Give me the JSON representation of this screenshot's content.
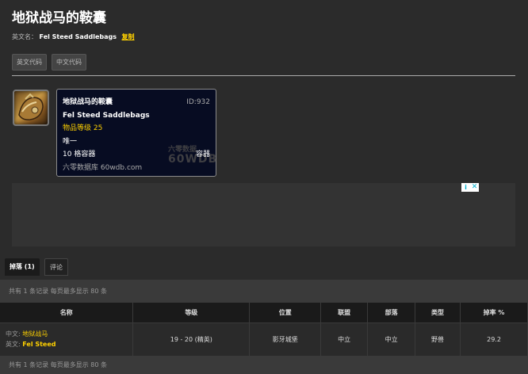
{
  "item": {
    "title": "地狱战马的鞍囊",
    "en_label": "英文名：",
    "en_name": "Fel Steed Saddlebags",
    "copy_label": "复制",
    "icon": "saddlebag-icon"
  },
  "code_buttons": {
    "en_code": "英文代码",
    "cn_code": "中文代码"
  },
  "tooltip": {
    "cn_name": "地狱战马的鞍囊",
    "id_label": "ID:932",
    "en_name": "Fel Steed Saddlebags",
    "item_level": "物品等级 25",
    "unique": "唯一",
    "slots": "10 格容器",
    "slot_type": "容器",
    "source": "六零数据库 60wdb.com",
    "watermark_cn": "六零数据",
    "watermark_en": "60WDB"
  },
  "ad": {
    "info_icon": "adchoices-icon",
    "close_icon": "close-icon",
    "info_glyph": "i",
    "close_glyph": "✕"
  },
  "tabs": {
    "drops": "掉落 (1)",
    "comments": "评论"
  },
  "summary": {
    "top": "共有 1 条记录 每页最多显示 80 条",
    "bottom": "共有 1 条记录 每页最多显示 80 条"
  },
  "table": {
    "headers": [
      "名称",
      "等级",
      "位置",
      "联盟",
      "部落",
      "类型",
      "掉率 %"
    ],
    "rows": [
      {
        "cn_label": "中文:",
        "cn_name": "地狱战马",
        "en_label": "英文:",
        "en_name": "Fel Steed",
        "level": "19 - 20 (精英)",
        "location": "影牙城堡",
        "alliance": "中立",
        "horde": "中立",
        "type": "野兽",
        "rate": "29.2"
      }
    ]
  },
  "colors": {
    "accent": "#ffd100",
    "background": "#2b2b2b",
    "tooltip_bg": "#070c22"
  }
}
